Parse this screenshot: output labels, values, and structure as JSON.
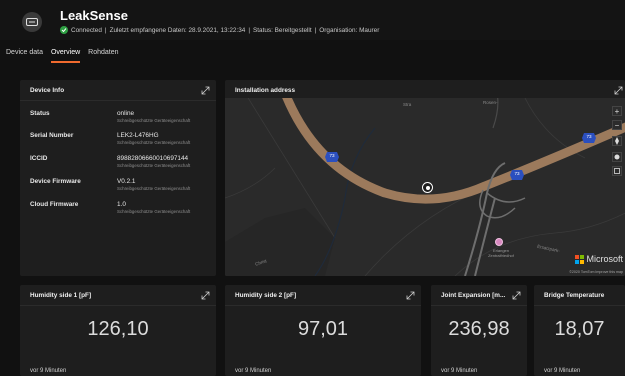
{
  "header": {
    "title": "LeakSense",
    "status": {
      "connected": "Connected",
      "sep1": "|",
      "last_received": "Zuletzt empfangene Daten: 28.9.2021, 13:22:34",
      "sep2": "|",
      "status_text": "Status: Bereitgestellt",
      "sep3": "|",
      "organisation": "Organisation: Maurer"
    }
  },
  "tabs": [
    {
      "label": "Device data",
      "active": false
    },
    {
      "label": "Overview",
      "active": true
    },
    {
      "label": "Rohdaten",
      "active": false
    }
  ],
  "device_info": {
    "title": "Device Info",
    "rows": [
      {
        "label": "Status",
        "value": "online",
        "sub": "Schreibgeschützte Geräteeigenschaft"
      },
      {
        "label": "Serial Number",
        "value": "LEK2-L476HG",
        "sub": "Schreibgeschützte Geräteeigenschaft"
      },
      {
        "label": "ICCID",
        "value": "89882806660010697144",
        "sub": "Schreibgeschützte Geräteeigenschaft"
      },
      {
        "label": "Device Firmware",
        "value": "V0.2.1",
        "sub": "Schreibgeschützte Geräteeigenschaft"
      },
      {
        "label": "Cloud Firmware",
        "value": "1.0",
        "sub": "Schreibgeschützte Geräteeigenschaft"
      }
    ]
  },
  "map": {
    "title": "Installation address",
    "road_badges": [
      "73",
      "73",
      "73"
    ],
    "labels": [
      "Rosen-",
      "Stra",
      "Ersatzpark-",
      "Christ"
    ],
    "poi": [
      "Erlangen",
      "Zentralfriedhof"
    ],
    "brand": "Microsoft",
    "attribution": "©2020 TomTom  Improve this map",
    "controls": [
      "+",
      "−"
    ]
  },
  "metrics": [
    {
      "title": "Humidity side 1 [pF]",
      "value": "126,10",
      "footer": "vor 9 Minuten"
    },
    {
      "title": "Humidity side 2 [pF]",
      "value": "97,01",
      "footer": "vor 9 Minuten"
    },
    {
      "title": "Joint Expansion [m...",
      "value": "236,98",
      "footer": "vor 9 Minuten"
    },
    {
      "title": "Bridge Temperature",
      "value": "18,07",
      "footer": "vor 9 Minuten"
    }
  ],
  "icons": {
    "app": "device-icon",
    "connected": "check-circle-icon",
    "expand": "expand-icon"
  },
  "colors": {
    "background": "#111111",
    "card": "#1e1e1e",
    "accent_tab": "#f06a2e",
    "connected": "#2ea043",
    "road": "#9c7a5c",
    "road_badge": "#2b4fbf",
    "map_bg": "#2a2a2a"
  }
}
